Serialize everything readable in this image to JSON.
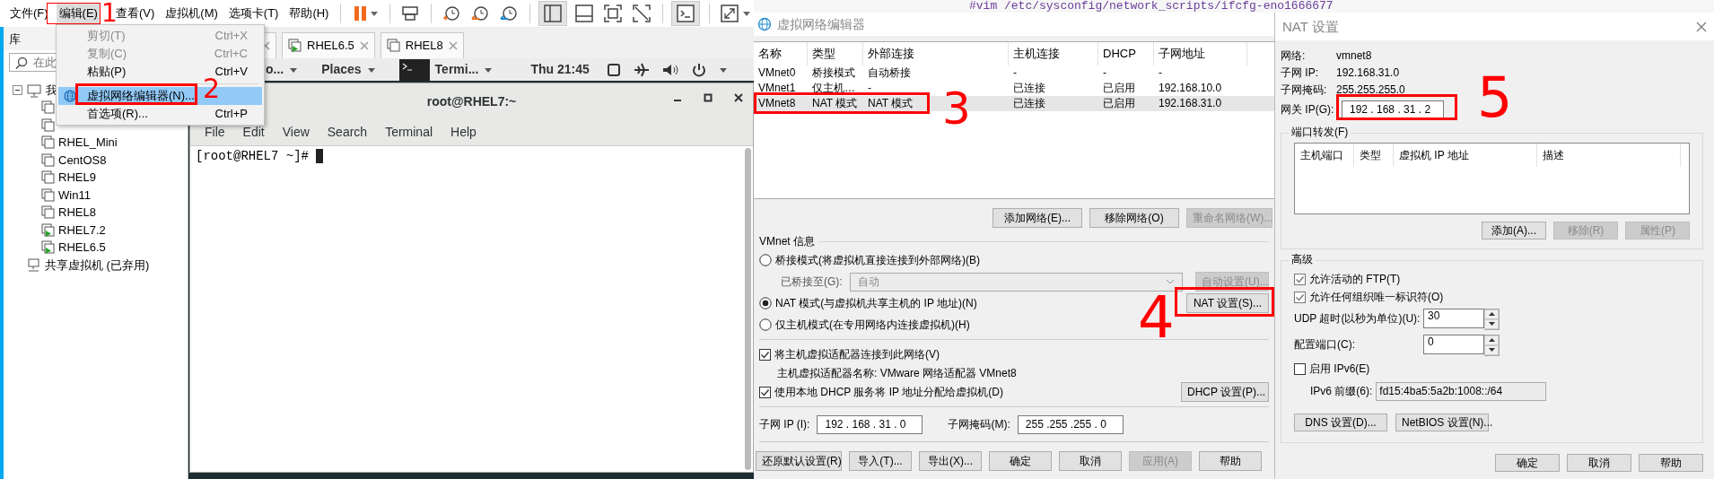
{
  "vmware": {
    "menu": [
      {
        "label": "文件(F)",
        "selected": false
      },
      {
        "label": "编辑(E)",
        "selected": true
      },
      {
        "label": "查看(V)",
        "selected": false
      },
      {
        "label": "虚拟机(M)",
        "selected": false
      },
      {
        "label": "选项卡(T)",
        "selected": false
      },
      {
        "label": "帮助(H)",
        "selected": false
      }
    ],
    "edit_menu": [
      {
        "kind": "item",
        "label": "剪切(T)",
        "shortcut": "Ctrl+X",
        "disabled": true,
        "selected": false,
        "has_icon": false
      },
      {
        "kind": "item",
        "label": "复制(C)",
        "shortcut": "Ctrl+C",
        "disabled": true,
        "selected": false,
        "has_icon": false
      },
      {
        "kind": "item",
        "label": "粘贴(P)",
        "shortcut": "Ctrl+V",
        "disabled": false,
        "selected": false,
        "has_icon": false
      },
      {
        "kind": "separator"
      },
      {
        "kind": "item",
        "label": "虚拟网络编辑器(N)...",
        "disabled": false,
        "selected": true,
        "has_icon": true
      },
      {
        "kind": "item",
        "label": "首选项(R)...",
        "shortcut": "Ctrl+P",
        "disabled": false,
        "selected": false,
        "has_icon": false
      }
    ],
    "library": {
      "title": "库",
      "search_placeholder": "在此",
      "tree": {
        "label": "我",
        "expanded": true,
        "children": [
          {
            "running": false
          },
          {
            "running": false
          },
          {
            "label": "RHEL_Mini",
            "running": false
          },
          {
            "label": "CentOS8",
            "running": false
          },
          {
            "label": "RHEL9",
            "running": false
          },
          {
            "label": "Win11",
            "running": false
          },
          {
            "label": "RHEL8",
            "running": false
          },
          {
            "label": "RHEL7.2",
            "running": true
          },
          {
            "label": "RHEL6.5",
            "running": true
          }
        ]
      },
      "shared": "共享虚拟机 (已弃用)"
    },
    "tabs": [
      {
        "label": "RHEL6.5",
        "running": true
      },
      {
        "label": "RHEL8",
        "running": false
      }
    ],
    "top_bar": {
      "apps": "o...",
      "places": "Places",
      "window": "Termi...",
      "clock": "Thu 21:45"
    },
    "terminal": {
      "title": "root@RHEL7:~",
      "menu": [
        "File",
        "Edit",
        "View",
        "Search",
        "Terminal",
        "Help"
      ],
      "prompt": "[root@RHEL7 ~]#"
    }
  },
  "background_text": "#vim /etc/sysconfig/network_scripts/ifcfg-eno1666677",
  "network_editor": {
    "title": "虚拟网络编辑器",
    "columns": [
      "名称",
      "类型",
      "外部连接",
      "主机连接",
      "DHCP",
      "子网地址"
    ],
    "rows": [
      {
        "cells": [
          "VMnet0",
          "桥接模式",
          "自动桥接",
          "-",
          "-",
          "-"
        ],
        "selected": false
      },
      {
        "cells": [
          "VMnet1",
          "仅主机…",
          "-",
          "已连接",
          "已启用",
          "192.168.10.0"
        ],
        "selected": false
      },
      {
        "cells": [
          "VMnet8",
          "NAT 模式",
          "NAT 模式",
          "已连接",
          "已启用",
          "192.168.31.0"
        ],
        "selected": true
      }
    ],
    "list_buttons": [
      {
        "label": "添加网络(E)...",
        "disabled": false
      },
      {
        "label": "移除网络(O)",
        "disabled": false
      },
      {
        "label": "重命名网络(W)...",
        "disabled": true
      }
    ],
    "info_title": "VMnet 信息",
    "modes": [
      {
        "label": "桥接模式(将虚拟机直接连接到外部网络)(B)",
        "selected": false
      },
      {
        "label": "NAT 模式(与虚拟机共享主机的 IP 地址)(N)",
        "selected": true
      },
      {
        "label": "仅主机模式(在专用网络内连接虚拟机)(H)",
        "selected": false
      }
    ],
    "bridged_to": {
      "label": "已桥接至(G):",
      "value": "自动",
      "disabled": true,
      "button": "自动设置(U)..."
    },
    "nat_button": "NAT 设置(S)...",
    "connect_adapter": {
      "label": "将主机虚拟适配器连接到此网络(V)",
      "checked": true
    },
    "adapter_name": "主机虚拟适配器名称: VMware 网络适配器 VMnet8",
    "use_dhcp": {
      "label": "使用本地 DHCP 服务将 IP 地址分配给虚拟机(D)",
      "checked": true
    },
    "dhcp_button": "DHCP 设置(P)...",
    "subnet_ip": {
      "label": "子网 IP (I):",
      "value": "192 . 168 . 31 . 0"
    },
    "subnet_mask": {
      "label": "子网掩码(M):",
      "value": "255 .255 .255 . 0"
    },
    "footer_buttons": [
      {
        "label": "还原默认设置(R)",
        "disabled": false
      },
      {
        "label": "导入(T)...",
        "disabled": false
      },
      {
        "label": "导出(X)...",
        "disabled": false
      },
      {
        "label": "确定",
        "disabled": false
      },
      {
        "label": "取消",
        "disabled": false
      },
      {
        "label": "应用(A)",
        "disabled": true
      },
      {
        "label": "帮助",
        "disabled": false
      }
    ]
  },
  "nat_settings": {
    "title": "NAT 设置",
    "info": [
      {
        "label": "网络:",
        "value": "vmnet8"
      },
      {
        "label": "子网 IP:",
        "value": "192.168.31.0"
      },
      {
        "label": "子网掩码:",
        "value": "255.255.255.0"
      }
    ],
    "gateway": {
      "label": "网关 IP(G):",
      "value": "192 . 168 . 31 . 2"
    },
    "port_forwarding": {
      "title": "端口转发(F)",
      "columns": [
        "主机端口",
        "类型",
        "虚拟机 IP 地址",
        "描述"
      ],
      "buttons": [
        {
          "label": "添加(A)...",
          "disabled": false
        },
        {
          "label": "移除(R)",
          "disabled": true
        },
        {
          "label": "属性(P)",
          "disabled": true
        }
      ]
    },
    "advanced": {
      "title": "高级",
      "options": [
        {
          "label": "允许活动的 FTP(T)",
          "checked": true
        },
        {
          "label": "允许任何组织唯一标识符(O)",
          "checked": true
        }
      ],
      "udp_timeout": {
        "label": "UDP 超时(以秒为单位)(U):",
        "value": "30"
      },
      "config_port": {
        "label": "配置端口(C):",
        "value": "0"
      },
      "ipv6": {
        "label": "启用 IPv6(E)",
        "checked": false
      },
      "ipv6_prefix": {
        "label": "IPv6 前缀(6):",
        "value": "fd15:4ba5:5a2b:1008::/64",
        "disabled": true
      },
      "buttons": [
        "DNS 设置(D)...",
        "NetBIOS 设置(N)..."
      ]
    },
    "footer_buttons": [
      "确定",
      "取消",
      "帮助"
    ]
  },
  "annotations": [
    "1",
    "2",
    "3",
    "4",
    "5"
  ]
}
